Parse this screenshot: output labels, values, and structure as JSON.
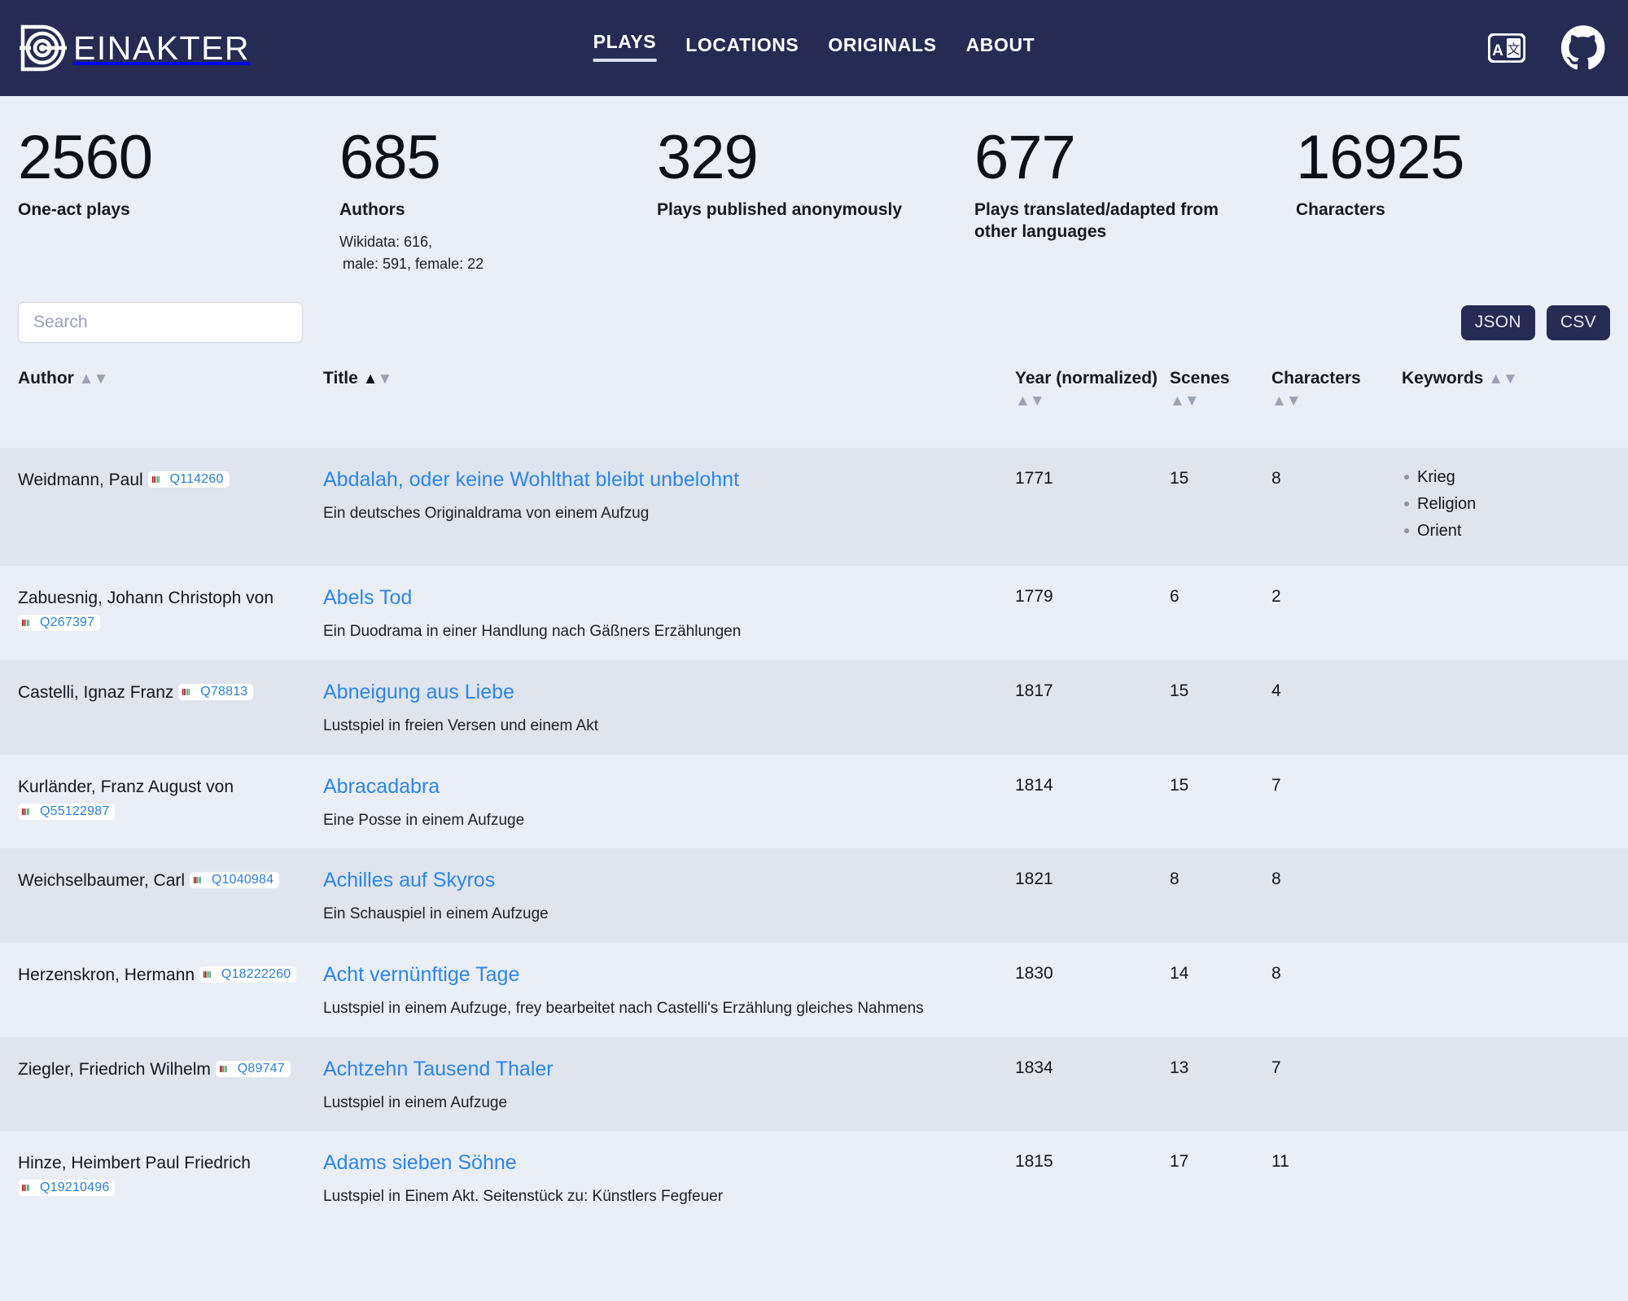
{
  "header": {
    "brand_text": "EINAKTER",
    "brand_icon": "dc-monogram-logo",
    "nav": [
      {
        "label": "PLAYS",
        "active": true
      },
      {
        "label": "LOCATIONS",
        "active": false
      },
      {
        "label": "ORIGINALS",
        "active": false
      },
      {
        "label": "ABOUT",
        "active": false
      }
    ],
    "language_icon": "translate-icon",
    "github_icon": "github-icon",
    "bg_color": "#252b52"
  },
  "stats": [
    {
      "number": "2560",
      "label": "One-act plays",
      "sub": []
    },
    {
      "number": "685",
      "label": "Authors",
      "sub": [
        "Wikidata: 616,",
        "male: 591, female: 22"
      ]
    },
    {
      "number": "329",
      "label": "Plays published anonymously",
      "sub": []
    },
    {
      "number": "677",
      "label": "Plays translated/adapted from other languages",
      "sub": []
    },
    {
      "number": "16925",
      "label": "Characters",
      "sub": []
    }
  ],
  "toolbar": {
    "search_placeholder": "Search",
    "search_value": "",
    "json_label": "JSON",
    "csv_label": "CSV"
  },
  "table": {
    "columns": [
      {
        "label": "Author",
        "sort_active": false
      },
      {
        "label": "Title",
        "sort_active": true
      },
      {
        "label": "Year (normalized)",
        "sort_active": false
      },
      {
        "label": "Scenes",
        "sort_active": false
      },
      {
        "label": "Characters",
        "sort_active": false
      },
      {
        "label": "Keywords",
        "sort_active": false
      }
    ],
    "rows": [
      {
        "author": "Weidmann, Paul",
        "qid": "Q114260",
        "title": "Abdalah, oder keine Wohlthat bleibt unbelohnt",
        "subtitle": "Ein deutsches Originaldrama von einem Aufzug",
        "year": "1771",
        "scenes": "15",
        "characters": "8",
        "keywords": [
          "Krieg",
          "Religion",
          "Orient"
        ]
      },
      {
        "author": "Zabuesnig, Johann Christoph von",
        "qid": "Q267397",
        "title": "Abels Tod",
        "subtitle": "Ein Duodrama in einer Handlung nach Gäßners Erzählungen",
        "year": "1779",
        "scenes": "6",
        "characters": "2",
        "keywords": []
      },
      {
        "author": "Castelli, Ignaz Franz",
        "qid": "Q78813",
        "title": "Abneigung aus Liebe",
        "subtitle": "Lustspiel in freien Versen und einem Akt",
        "year": "1817",
        "scenes": "15",
        "characters": "4",
        "keywords": []
      },
      {
        "author": "Kurländer, Franz August von",
        "qid": "Q55122987",
        "title": "Abracadabra",
        "subtitle": "Eine Posse in einem Aufzuge",
        "year": "1814",
        "scenes": "15",
        "characters": "7",
        "keywords": []
      },
      {
        "author": "Weichselbaumer, Carl",
        "qid": "Q1040984",
        "title": "Achilles auf Skyros",
        "subtitle": "Ein Schauspiel in einem Aufzuge",
        "year": "1821",
        "scenes": "8",
        "characters": "8",
        "keywords": []
      },
      {
        "author": "Herzenskron, Hermann",
        "qid": "Q18222260",
        "title": "Acht vernünftige Tage",
        "subtitle": "Lustspiel in einem Aufzuge, frey bearbeitet nach Castelli's Erzählung gleiches Nahmens",
        "year": "1830",
        "scenes": "14",
        "characters": "8",
        "keywords": []
      },
      {
        "author": "Ziegler, Friedrich Wilhelm",
        "qid": "Q89747",
        "title": "Achtzehn Tausend Thaler",
        "subtitle": "Lustspiel in einem Aufzuge",
        "year": "1834",
        "scenes": "13",
        "characters": "7",
        "keywords": []
      },
      {
        "author": "Hinze, Heimbert Paul Friedrich",
        "qid": "Q19210496",
        "title": "Adams sieben Söhne",
        "subtitle": "Lustspiel in Einem Akt. Seitenstück zu: Künstlers Fegfeuer",
        "year": "1815",
        "scenes": "17",
        "characters": "11",
        "keywords": []
      }
    ]
  },
  "colors": {
    "nav_bg": "#252b52",
    "page_bg": "#eaeef6",
    "row_alt_bg": "#dfe4ee",
    "link": "#2d86e8",
    "qid_text": "#2a7fd4"
  }
}
